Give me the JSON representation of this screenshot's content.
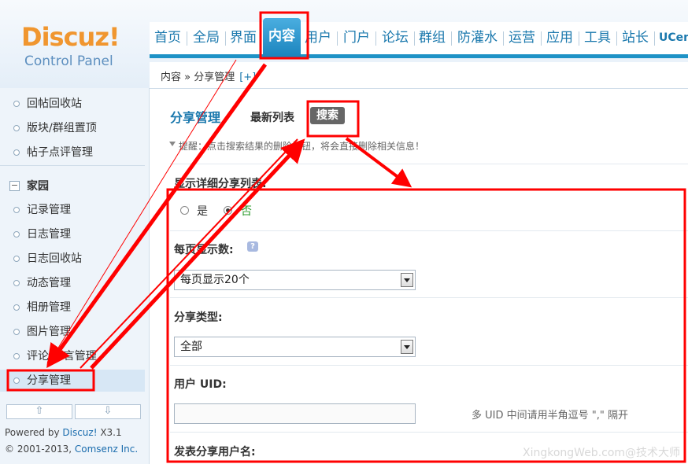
{
  "logo": {
    "brand": "Discuz!",
    "subtitle": "Control Panel"
  },
  "nav": {
    "items": [
      "首页",
      "全局",
      "界面",
      "内容",
      "用户",
      "门户",
      "论坛",
      "群组",
      "防灌水",
      "运营",
      "应用",
      "工具",
      "站长",
      "UCen"
    ],
    "active": "内容"
  },
  "breadcrumb": {
    "path": "内容 » 分享管理",
    "add": "[+]"
  },
  "sidebar": {
    "items_top": [
      "回帖回收站",
      "版块/群组置顶",
      "帖子点评管理"
    ],
    "group_label": "家园",
    "group_toggle": "−",
    "items_group": [
      "记录管理",
      "日志管理",
      "日志回收站",
      "动态管理",
      "相册管理",
      "图片管理",
      "评论/留言管理",
      "分享管理"
    ],
    "active": "分享管理",
    "scroll_up": "⇧",
    "scroll_down": "⇩"
  },
  "footer": {
    "powered_prefix": "Powered by ",
    "powered_brand": "Discuz!",
    "powered_version": " X3.1",
    "copyright_prefix": "© 2001-2013, ",
    "copyright_brand": "Comsenz Inc."
  },
  "main": {
    "title": "分享管理",
    "tab_latest": "最新列表",
    "tab_search": "搜索",
    "tip": "提醒：点击搜索结果的删除按钮，将会直接删除相关信息！",
    "detail_label": "显示详细分享列表:",
    "radio_yes": "是",
    "radio_no": "否",
    "per_page_label": "每页显示数:",
    "help_icon": "?",
    "per_page_value": "每页显示20个",
    "share_type_label": "分享类型:",
    "share_type_value": "全部",
    "uid_label": "用户 UID:",
    "uid_value": "",
    "uid_tip": "多 UID 中间请用半角逗号 \",\" 隔开",
    "username_label": "发表分享用户名:"
  },
  "watermark": "XingkongWeb.com@技术大师",
  "colors": {
    "accent": "#1e92c6",
    "annotation": "#ff0000",
    "logo_orange": "#f0962f"
  }
}
